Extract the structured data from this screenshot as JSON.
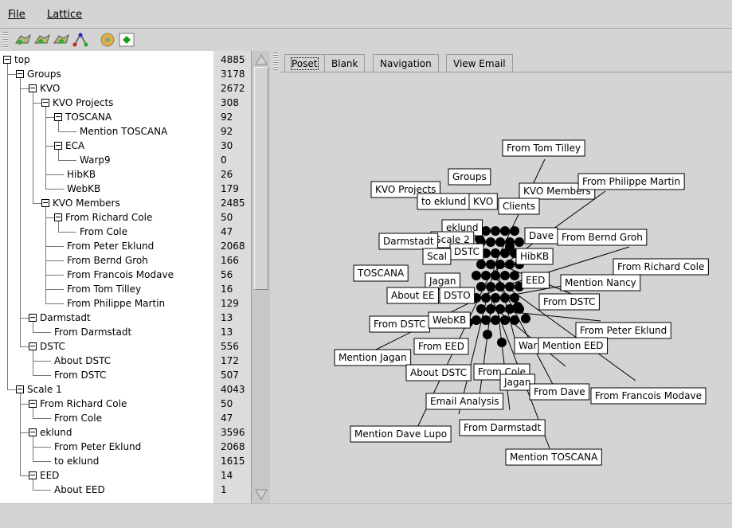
{
  "menu": {
    "file": "File",
    "lattice": "Lattice"
  },
  "toolbar": {
    "buttons": [
      "zoom-in-icon",
      "zoom-out-icon",
      "reset-zoom-icon",
      "lattice-icon",
      "gear-icon",
      "diamond-icon"
    ]
  },
  "tree": [
    {
      "label": "top",
      "count": "4885",
      "depth": 0,
      "expand": true
    },
    {
      "label": "Groups",
      "count": "3178",
      "depth": 1,
      "expand": true
    },
    {
      "label": "KVO",
      "count": "2672",
      "depth": 2,
      "expand": true
    },
    {
      "label": "KVO Projects",
      "count": "308",
      "depth": 3,
      "expand": true
    },
    {
      "label": "TOSCANA",
      "count": "92",
      "depth": 4,
      "expand": true
    },
    {
      "label": "Mention TOSCANA",
      "count": "92",
      "depth": 5,
      "expand": false
    },
    {
      "label": "ECA",
      "count": "30",
      "depth": 4,
      "expand": true
    },
    {
      "label": "Warp9",
      "count": "0",
      "depth": 5,
      "expand": false
    },
    {
      "label": "HibKB",
      "count": "26",
      "depth": 4,
      "expand": false
    },
    {
      "label": "WebKB",
      "count": "179",
      "depth": 4,
      "expand": false
    },
    {
      "label": "KVO Members",
      "count": "2485",
      "depth": 3,
      "expand": true
    },
    {
      "label": "From Richard Cole",
      "count": "50",
      "depth": 4,
      "expand": true
    },
    {
      "label": "From Cole",
      "count": "47",
      "depth": 5,
      "expand": false
    },
    {
      "label": "From Peter Eklund",
      "count": "2068",
      "depth": 4,
      "expand": false
    },
    {
      "label": "From Bernd Groh",
      "count": "166",
      "depth": 4,
      "expand": false
    },
    {
      "label": "From Francois Modave",
      "count": "56",
      "depth": 4,
      "expand": false
    },
    {
      "label": "From Tom Tilley",
      "count": "16",
      "depth": 4,
      "expand": false
    },
    {
      "label": "From Philippe Martin",
      "count": "129",
      "depth": 4,
      "expand": false
    },
    {
      "label": "Darmstadt",
      "count": "13",
      "depth": 2,
      "expand": true
    },
    {
      "label": "From Darmstadt",
      "count": "13",
      "depth": 3,
      "expand": false
    },
    {
      "label": "DSTC",
      "count": "556",
      "depth": 2,
      "expand": true
    },
    {
      "label": "About DSTC",
      "count": "172",
      "depth": 3,
      "expand": false
    },
    {
      "label": "From DSTC",
      "count": "507",
      "depth": 3,
      "expand": false
    },
    {
      "label": "Scale 1",
      "count": "4043",
      "depth": 1,
      "expand": true
    },
    {
      "label": "From Richard Cole",
      "count": "50",
      "depth": 2,
      "expand": true
    },
    {
      "label": "From Cole",
      "count": "47",
      "depth": 3,
      "expand": false
    },
    {
      "label": "eklund",
      "count": "3596",
      "depth": 2,
      "expand": true
    },
    {
      "label": "From Peter Eklund",
      "count": "2068",
      "depth": 3,
      "expand": false
    },
    {
      "label": "to eklund",
      "count": "1615",
      "depth": 3,
      "expand": false
    },
    {
      "label": "EED",
      "count": "14",
      "depth": 2,
      "expand": true
    },
    {
      "label": "About EED",
      "count": "1",
      "depth": 3,
      "expand": false
    }
  ],
  "tabs": [
    "Poset",
    "Blank",
    "Navigation",
    "View Email"
  ],
  "active_tab": "Poset",
  "graph": {
    "labels": [
      "From Tom Tilley",
      "Groups",
      "KVO Projects",
      "KVO Members",
      "From Philippe Martin",
      "to eklund",
      "KVO",
      "Clients",
      "eklund",
      "Scale 2",
      "Dave",
      "From Bernd Groh",
      "Darmstadt",
      "DSTC",
      "Scal",
      "HibKB",
      "From Richard Cole",
      "TOSCANA",
      "Jagan",
      "EED",
      "Mention Nancy",
      "About EE",
      "DSTO",
      "From DSTC",
      "From DSTC",
      "WebKB",
      "From Peter Eklund",
      "From EED",
      "Warp",
      "Mention EED",
      "Mention Jagan",
      "About DSTC",
      "From Cole",
      "Jagan",
      "From Dave",
      "From Francois Modave",
      "Email Analysis",
      "Mention Dave Lupo",
      "From Darmstadt",
      "Mention TOSCANA"
    ]
  }
}
